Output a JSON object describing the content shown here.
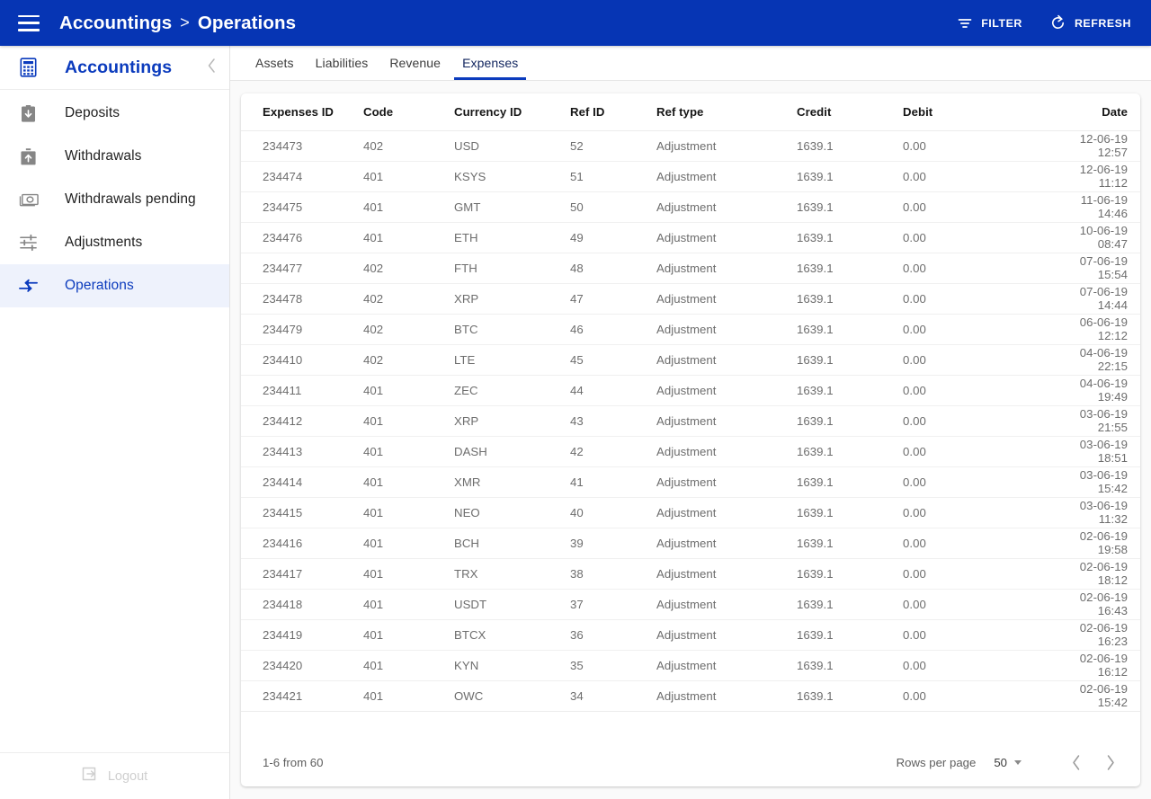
{
  "topbar": {
    "menu_icon": "hamburger-menu-icon",
    "breadcrumb_root": "Accountings",
    "breadcrumb_separator": ">",
    "breadcrumb_current": "Operations",
    "filter_label": "FILTER",
    "refresh_label": "REFRESH",
    "background_color": "#0635b4"
  },
  "sidebar": {
    "logo_icon": "calculator-icon",
    "title": "Accountings",
    "collapse_icon": "chevron-left-icon",
    "accent_color": "#0b3bbd",
    "active_background": "#eef2fc",
    "items": [
      {
        "label": "Deposits",
        "icon": "deposit-box-down-arrow-icon",
        "active": false
      },
      {
        "label": "Withdrawals",
        "icon": "withdrawal-box-up-arrow-icon",
        "active": false
      },
      {
        "label": "Withdrawals pending",
        "icon": "banknote-icon",
        "active": false
      },
      {
        "label": "Adjustments",
        "icon": "sliders-icon",
        "active": false
      },
      {
        "label": "Operations",
        "icon": "arrows-transfer-icon",
        "active": true
      }
    ],
    "logout": {
      "label": "Logout",
      "icon": "logout-arrow-icon"
    }
  },
  "tabs": [
    {
      "label": "Assets",
      "active": false
    },
    {
      "label": "Liabilities",
      "active": false
    },
    {
      "label": "Revenue",
      "active": false
    },
    {
      "label": "Expenses",
      "active": true
    }
  ],
  "table": {
    "columns": [
      "Expenses ID",
      "Code",
      "Currency ID",
      "Ref ID",
      "Ref type",
      "Credit",
      "Debit",
      "Date"
    ],
    "rows": [
      {
        "id": "234473",
        "code": "402",
        "currency": "USD",
        "ref_id": "52",
        "ref_type": "Adjustment",
        "credit": "1639.1",
        "debit": "0.00",
        "date": "12-06-19 12:57"
      },
      {
        "id": "234474",
        "code": "401",
        "currency": "KSYS",
        "ref_id": "51",
        "ref_type": "Adjustment",
        "credit": "1639.1",
        "debit": "0.00",
        "date": "12-06-19 11:12"
      },
      {
        "id": "234475",
        "code": "401",
        "currency": "GMT",
        "ref_id": "50",
        "ref_type": "Adjustment",
        "credit": "1639.1",
        "debit": "0.00",
        "date": "11-06-19 14:46"
      },
      {
        "id": "234476",
        "code": "401",
        "currency": "ETH",
        "ref_id": "49",
        "ref_type": "Adjustment",
        "credit": "1639.1",
        "debit": "0.00",
        "date": "10-06-19 08:47"
      },
      {
        "id": "234477",
        "code": "402",
        "currency": "FTH",
        "ref_id": "48",
        "ref_type": "Adjustment",
        "credit": "1639.1",
        "debit": "0.00",
        "date": "07-06-19 15:54"
      },
      {
        "id": "234478",
        "code": "402",
        "currency": "XRP",
        "ref_id": "47",
        "ref_type": "Adjustment",
        "credit": "1639.1",
        "debit": "0.00",
        "date": "07-06-19 14:44"
      },
      {
        "id": "234479",
        "code": "402",
        "currency": "BTC",
        "ref_id": "46",
        "ref_type": "Adjustment",
        "credit": "1639.1",
        "debit": "0.00",
        "date": "06-06-19 12:12"
      },
      {
        "id": "234410",
        "code": "402",
        "currency": "LTE",
        "ref_id": "45",
        "ref_type": "Adjustment",
        "credit": "1639.1",
        "debit": "0.00",
        "date": "04-06-19 22:15"
      },
      {
        "id": "234411",
        "code": "401",
        "currency": "ZEC",
        "ref_id": "44",
        "ref_type": "Adjustment",
        "credit": "1639.1",
        "debit": "0.00",
        "date": "04-06-19 19:49"
      },
      {
        "id": "234412",
        "code": "401",
        "currency": "XRP",
        "ref_id": "43",
        "ref_type": "Adjustment",
        "credit": "1639.1",
        "debit": "0.00",
        "date": "03-06-19 21:55"
      },
      {
        "id": "234413",
        "code": "401",
        "currency": "DASH",
        "ref_id": "42",
        "ref_type": "Adjustment",
        "credit": "1639.1",
        "debit": "0.00",
        "date": "03-06-19 18:51"
      },
      {
        "id": "234414",
        "code": "401",
        "currency": "XMR",
        "ref_id": "41",
        "ref_type": "Adjustment",
        "credit": "1639.1",
        "debit": "0.00",
        "date": "03-06-19 15:42"
      },
      {
        "id": "234415",
        "code": "401",
        "currency": "NEO",
        "ref_id": "40",
        "ref_type": "Adjustment",
        "credit": "1639.1",
        "debit": "0.00",
        "date": "03-06-19 11:32"
      },
      {
        "id": "234416",
        "code": "401",
        "currency": "BCH",
        "ref_id": "39",
        "ref_type": "Adjustment",
        "credit": "1639.1",
        "debit": "0.00",
        "date": "02-06-19 19:58"
      },
      {
        "id": "234417",
        "code": "401",
        "currency": "TRX",
        "ref_id": "38",
        "ref_type": "Adjustment",
        "credit": "1639.1",
        "debit": "0.00",
        "date": "02-06-19 18:12"
      },
      {
        "id": "234418",
        "code": "401",
        "currency": "USDT",
        "ref_id": "37",
        "ref_type": "Adjustment",
        "credit": "1639.1",
        "debit": "0.00",
        "date": "02-06-19 16:43"
      },
      {
        "id": "234419",
        "code": "401",
        "currency": "BTCX",
        "ref_id": "36",
        "ref_type": "Adjustment",
        "credit": "1639.1",
        "debit": "0.00",
        "date": "02-06-19 16:23"
      },
      {
        "id": "234420",
        "code": "401",
        "currency": "KYN",
        "ref_id": "35",
        "ref_type": "Adjustment",
        "credit": "1639.1",
        "debit": "0.00",
        "date": "02-06-19 16:12"
      },
      {
        "id": "234421",
        "code": "401",
        "currency": "OWC",
        "ref_id": "34",
        "ref_type": "Adjustment",
        "credit": "1639.1",
        "debit": "0.00",
        "date": "02-06-19 15:42"
      }
    ]
  },
  "pagination": {
    "range_text": "1-6 from 60",
    "rows_per_page_label": "Rows per page",
    "rows_per_page_value": "50",
    "prev_icon": "chevron-left-icon",
    "next_icon": "chevron-right-icon"
  }
}
